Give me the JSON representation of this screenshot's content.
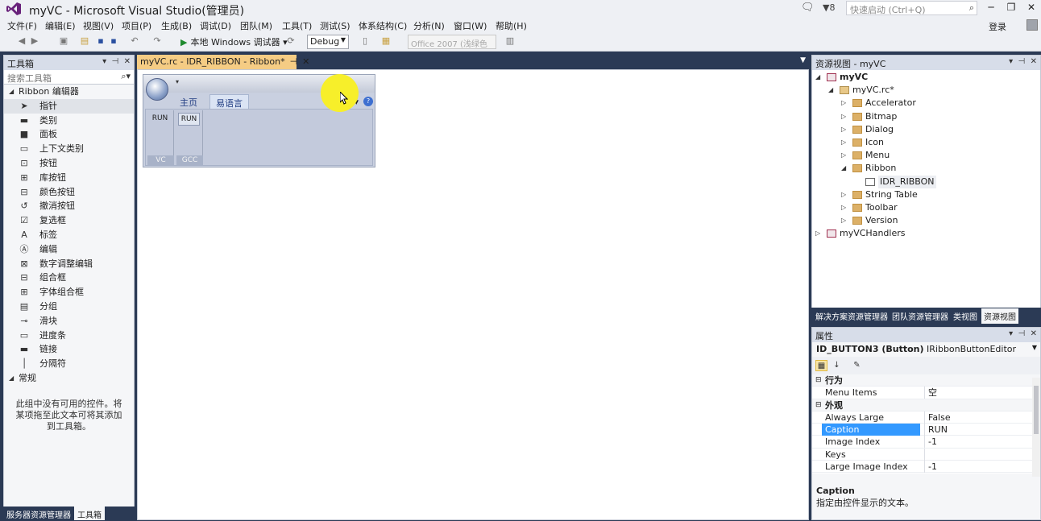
{
  "window": {
    "title": "myVC - Microsoft Visual Studio(管理员)",
    "notification_count": "8",
    "quick_launch_placeholder": "快速启动 (Ctrl+Q)",
    "login_label": "登录"
  },
  "menu": [
    "文件(F)",
    "编辑(E)",
    "视图(V)",
    "项目(P)",
    "生成(B)",
    "调试(D)",
    "团队(M)",
    "工具(T)",
    "测试(S)",
    "体系结构(C)",
    "分析(N)",
    "窗口(W)",
    "帮助(H)"
  ],
  "toolbar": {
    "run_label": "本地 Windows 调试器",
    "configuration": "Debug",
    "style_value": "Office 2007 (浅绿色"
  },
  "toolbox": {
    "title": "工具箱",
    "search_placeholder": "搜索工具箱",
    "group_ribbon": "Ribbon 编辑器",
    "items": [
      {
        "label": "指针",
        "icon": "pointer-icon"
      },
      {
        "label": "类别",
        "icon": "category-icon"
      },
      {
        "label": "面板",
        "icon": "panel-icon"
      },
      {
        "label": "上下文类别",
        "icon": "context-category-icon"
      },
      {
        "label": "按钮",
        "icon": "button-icon"
      },
      {
        "label": "库按钮",
        "icon": "gallery-button-icon"
      },
      {
        "label": "颜色按钮",
        "icon": "color-button-icon"
      },
      {
        "label": "撤消按钮",
        "icon": "undo-button-icon"
      },
      {
        "label": "复选框",
        "icon": "checkbox-icon"
      },
      {
        "label": "标签",
        "icon": "label-icon"
      },
      {
        "label": "编辑",
        "icon": "edit-icon"
      },
      {
        "label": "数字调整编辑",
        "icon": "spin-edit-icon"
      },
      {
        "label": "组合框",
        "icon": "combobox-icon"
      },
      {
        "label": "字体组合框",
        "icon": "font-combobox-icon"
      },
      {
        "label": "分组",
        "icon": "group-icon"
      },
      {
        "label": "滑块",
        "icon": "slider-icon"
      },
      {
        "label": "进度条",
        "icon": "progress-icon"
      },
      {
        "label": "链接",
        "icon": "link-icon"
      },
      {
        "label": "分隔符",
        "icon": "separator-icon"
      }
    ],
    "group_general": "常规",
    "empty_message": "此组中没有可用的控件。将某项拖至此文本可将其添加到工具箱。",
    "bottom_tabs": [
      "服务器资源管理器",
      "工具箱"
    ]
  },
  "document": {
    "tab_title": "myVC.rc - IDR_RIBBON - Ribbon*"
  },
  "ribbon": {
    "tabs": [
      "主页",
      "易语言"
    ],
    "style_label": "样式",
    "panels": [
      {
        "button": "RUN",
        "label": "VC"
      },
      {
        "button": "RUN",
        "label": "GCC"
      }
    ]
  },
  "resource_view": {
    "title": "资源视图 - myVC",
    "tree": [
      {
        "label": "myVC",
        "level": 0,
        "expanded": true,
        "kind": "project"
      },
      {
        "label": "myVC.rc*",
        "level": 1,
        "expanded": true,
        "kind": "rc"
      },
      {
        "label": "Accelerator",
        "level": 2,
        "expanded": false,
        "kind": "folder"
      },
      {
        "label": "Bitmap",
        "level": 2,
        "expanded": false,
        "kind": "folder"
      },
      {
        "label": "Dialog",
        "level": 2,
        "expanded": false,
        "kind": "folder"
      },
      {
        "label": "Icon",
        "level": 2,
        "expanded": false,
        "kind": "folder"
      },
      {
        "label": "Menu",
        "level": 2,
        "expanded": false,
        "kind": "folder"
      },
      {
        "label": "Ribbon",
        "level": 2,
        "expanded": true,
        "kind": "folder"
      },
      {
        "label": "IDR_RIBBON",
        "level": 3,
        "expanded": null,
        "kind": "ribbon"
      },
      {
        "label": "String Table",
        "level": 2,
        "expanded": false,
        "kind": "folder"
      },
      {
        "label": "Toolbar",
        "level": 2,
        "expanded": false,
        "kind": "folder"
      },
      {
        "label": "Version",
        "level": 2,
        "expanded": false,
        "kind": "folder"
      },
      {
        "label": "myVCHandlers",
        "level": 0,
        "expanded": false,
        "kind": "project"
      }
    ],
    "bottom_tabs": [
      "解决方案资源管理器",
      "团队资源管理器",
      "类视图",
      "资源视图"
    ]
  },
  "properties": {
    "title": "属性",
    "object_name": "ID_BUTTON3 (Button)",
    "object_type": "IRibbonButtonEditor",
    "rows": [
      {
        "type": "category",
        "name": "行为"
      },
      {
        "type": "prop",
        "name": "Menu Items",
        "value": "空"
      },
      {
        "type": "category",
        "name": "外观"
      },
      {
        "type": "prop",
        "name": "Always Large",
        "value": "False"
      },
      {
        "type": "prop",
        "name": "Caption",
        "value": "RUN",
        "selected": true
      },
      {
        "type": "prop",
        "name": "Image Index",
        "value": "-1"
      },
      {
        "type": "prop",
        "name": "Keys",
        "value": ""
      },
      {
        "type": "prop",
        "name": "Large Image Index",
        "value": "-1"
      }
    ],
    "description_title": "Caption",
    "description_text": "指定由控件显示的文本。"
  }
}
